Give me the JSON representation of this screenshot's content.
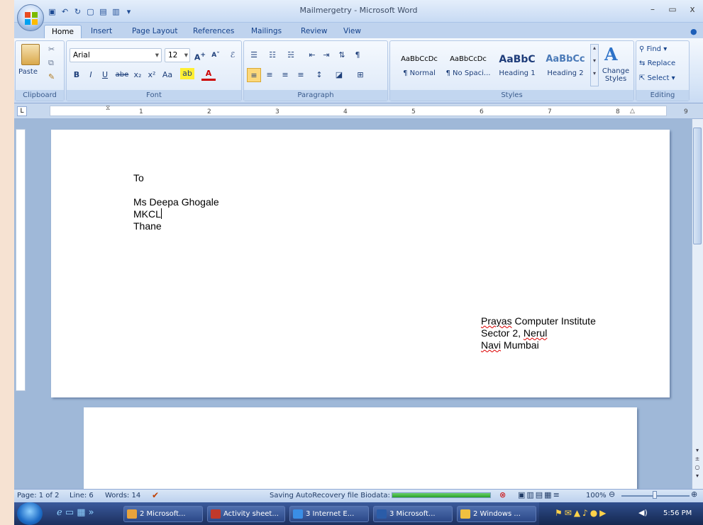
{
  "window": {
    "title": "Mailmergetry - Microsoft Word",
    "controls": {
      "minimize": "–",
      "restore": "▭",
      "close": "x"
    }
  },
  "tabs": [
    "Home",
    "Insert",
    "Page Layout",
    "References",
    "Mailings",
    "Review",
    "View"
  ],
  "active_tab": "Home",
  "ribbon": {
    "clipboard": {
      "label": "Clipboard",
      "paste": "Paste"
    },
    "font": {
      "label": "Font",
      "family": "Arial",
      "size": "12"
    },
    "paragraph": {
      "label": "Paragraph"
    },
    "styles": {
      "label": "Styles",
      "items": [
        {
          "sample": "AaBbCcDc",
          "name": "¶ Normal"
        },
        {
          "sample": "AaBbCcDc",
          "name": "¶ No Spaci..."
        },
        {
          "sample": "AaBbC",
          "name": "Heading 1"
        },
        {
          "sample": "AaBbCc",
          "name": "Heading 2"
        }
      ],
      "change_styles": "Change Styles"
    },
    "editing": {
      "label": "Editing",
      "find": "Find",
      "replace": "Replace",
      "select": "Select"
    }
  },
  "ruler": {
    "numbers": [
      "1",
      "2",
      "3",
      "4",
      "5",
      "6",
      "7",
      "8",
      "9"
    ]
  },
  "document": {
    "lines_left": [
      "To",
      "",
      "Ms Deepa Ghogale",
      "MKCL",
      "Thane"
    ],
    "address_right": {
      "line1_a": "Prayas",
      "line1_b": " Computer Institute",
      "line2_a": "Sector 2, ",
      "line2_b": "Nerul",
      "line3_a": "Navi",
      "line3_b": " Mumbai"
    }
  },
  "status": {
    "page": "Page: 1 of 2",
    "line": "Line: 6",
    "words": "Words: 14",
    "saving": "Saving AutoRecovery file Biodata:",
    "zoom": "100%"
  },
  "taskbar": {
    "items": [
      {
        "label": "2 Microsoft...",
        "color": "#e8a33c"
      },
      {
        "label": "Activity sheet...",
        "color": "#c0392b"
      },
      {
        "label": "3 Internet E...",
        "color": "#3a8ee6"
      },
      {
        "label": "3 Microsoft...",
        "color": "#2a5ca8"
      },
      {
        "label": "2 Windows ...",
        "color": "#f0c040"
      }
    ],
    "clock": "5:56 PM"
  }
}
